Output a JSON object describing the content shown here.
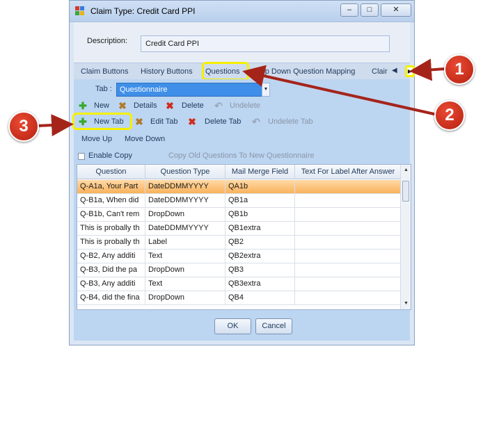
{
  "window": {
    "title": "Claim Type: Credit Card PPI",
    "min": "–",
    "max": "□",
    "close": "✕"
  },
  "description": {
    "label": "Description:",
    "value": "Credit Card PPI"
  },
  "tabs": [
    {
      "label": "Claim Buttons"
    },
    {
      "label": "History Buttons"
    },
    {
      "label": "Questions"
    },
    {
      "label": "Drop Down Question Mapping"
    },
    {
      "label": "Clair"
    }
  ],
  "tab_select": {
    "label": "Tab :",
    "value": "Questionnaire"
  },
  "toolbar1": {
    "new": "New",
    "details": "Details",
    "delete": "Delete",
    "undelete": "Undelete"
  },
  "toolbar2": {
    "new_tab": "New Tab",
    "edit_tab": "Edit Tab",
    "delete_tab": "Delete Tab",
    "undelete_tab": "Undelete Tab"
  },
  "toolbar3": {
    "move_up": "Move Up",
    "move_down": "Move Down"
  },
  "enable_copy": {
    "label": "Enable Copy",
    "copy_old": "Copy Old Questions To New Questionnaire"
  },
  "grid": {
    "columns": [
      "Question",
      "Question Type",
      "Mail Merge Field",
      "Text For Label After Answer"
    ],
    "rows": [
      [
        "Q-A1a, Your Part",
        "DateDDMMYYYY",
        "QA1b",
        ""
      ],
      [
        "Q-B1a, When did",
        "DateDDMMYYYY",
        "QB1a",
        ""
      ],
      [
        "Q-B1b, Can't rem",
        "DropDown",
        "QB1b",
        ""
      ],
      [
        "This is probally th",
        "DateDDMMYYYY",
        "QB1extra",
        ""
      ],
      [
        "This is probally th",
        "Label",
        "QB2",
        ""
      ],
      [
        "Q-B2, Any additi",
        "Text",
        "QB2extra",
        ""
      ],
      [
        "Q-B3, Did the pa",
        "DropDown",
        "QB3",
        ""
      ],
      [
        "Q-B3, Any additi",
        "Text",
        "QB3extra",
        ""
      ],
      [
        "Q-B4, did the fina",
        "DropDown",
        "QB4",
        ""
      ]
    ],
    "selected_row": 0
  },
  "buttons": {
    "ok": "OK",
    "cancel": "Cancel"
  },
  "callouts": [
    "1",
    "2",
    "3"
  ],
  "colors": {
    "highlight": "#f5f000",
    "callout": "#c92b17",
    "selected_row": "#f9b25c",
    "combo_selected": "#3f8fe8"
  }
}
